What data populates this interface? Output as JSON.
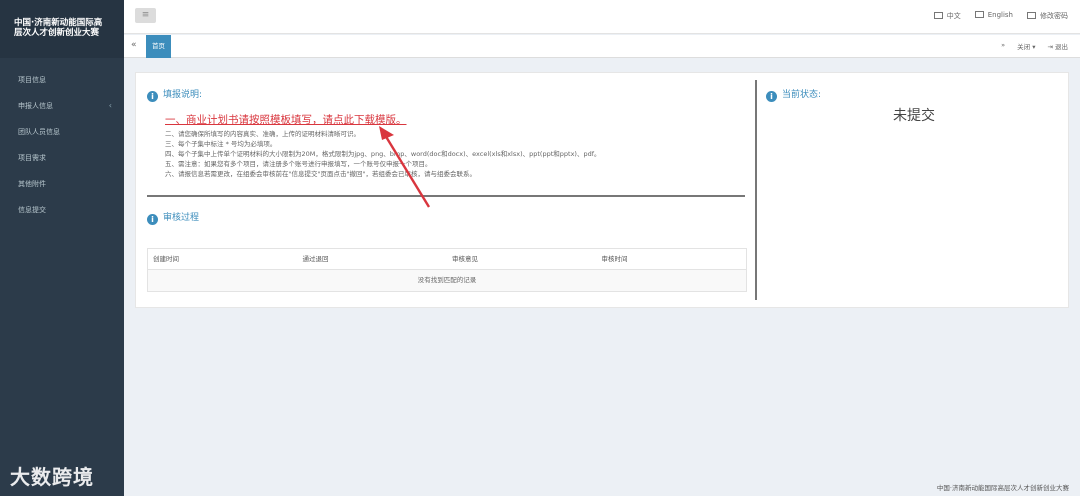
{
  "sidebar": {
    "brand_line1": "中国·济南新动能国际高",
    "brand_line2": "层次人才创新创业大赛",
    "items": [
      {
        "label": "项目信息"
      },
      {
        "label": "申报人信息"
      },
      {
        "label": "团队人员信息"
      },
      {
        "label": "项目需求"
      },
      {
        "label": "其他附件"
      },
      {
        "label": "信息提交"
      }
    ]
  },
  "watermark": "大数跨境",
  "topbar": {
    "menu_icon": "hamburger-icon",
    "lang_cn": "中文",
    "lang_en": "English",
    "change_password": "修改密码"
  },
  "tabs": {
    "home": "首页",
    "close_label": "关闭",
    "logout_label": "退出"
  },
  "instructions": {
    "title": "填报说明:",
    "main_link": "一、商业计划书请按照模板填写，请点此下载模版。",
    "lines": [
      "二、请您确保所填写的内容真实、准确，上传的证明材料清晰可识。",
      "三、每个子集中标注 * 号均为必填项。",
      "四、每个子集中上传单个证明材料的大小限制为20M，格式限制为jpg、png、bmp、word(doc和docx)、excel(xls和xlsx)、ppt(ppt和pptx)、pdf。",
      "五、需注意：如果您有多个项目，请注册多个账号进行申报填写，一个账号仅申报一个项目。",
      "六、请报信息若需更改，在组委会审核前在\"信息提交\"页面点击\"撤回\"，若组委会已审核，请与组委会联系。"
    ]
  },
  "review": {
    "title": "审核过程",
    "columns": [
      "创建时间",
      "通过退回",
      "审核意见",
      "审核时间"
    ],
    "empty_message": "没有找到匹配的记录"
  },
  "status": {
    "title": "当前状态:",
    "value": "未提交"
  },
  "footer": "中国·济南新动能国际高层次人才创新创业大赛",
  "colors": {
    "sidebar": "#2c3b4a",
    "accent": "#3c8dbc",
    "highlight_red": "#d9363e"
  }
}
